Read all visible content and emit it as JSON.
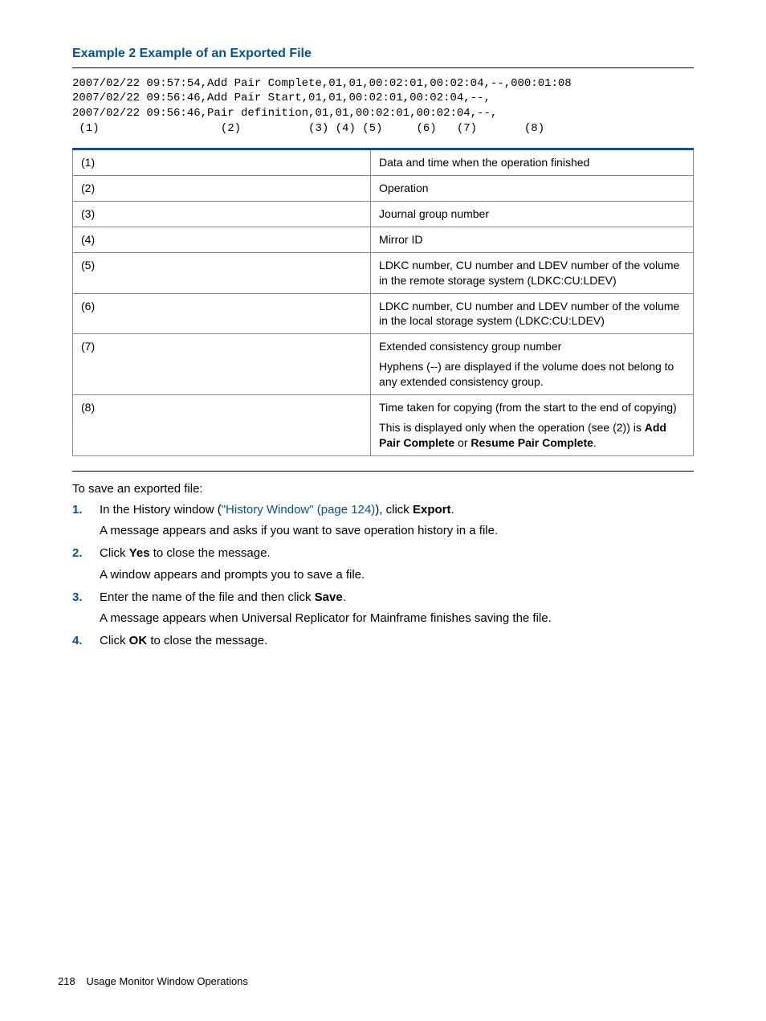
{
  "heading": "Example 2 Example of an Exported File",
  "code_lines": [
    "2007/02/22 09:57:54,Add Pair Complete,01,01,00:02:01,00:02:04,--,000:01:08",
    "2007/02/22 09:56:46,Add Pair Start,01,01,00:02:01,00:02:04,--,",
    "2007/02/22 09:56:46,Pair definition,01,01,00:02:01,00:02:04,--,",
    " (1)                  (2)          (3) (4) (5)     (6)   (7)       (8)"
  ],
  "table": {
    "rows": [
      {
        "key": "(1)",
        "desc": [
          {
            "type": "p",
            "parts": [
              {
                "t": "Data and time when the operation finished"
              }
            ]
          }
        ]
      },
      {
        "key": "(2)",
        "desc": [
          {
            "type": "p",
            "parts": [
              {
                "t": "Operation"
              }
            ]
          }
        ]
      },
      {
        "key": "(3)",
        "desc": [
          {
            "type": "p",
            "parts": [
              {
                "t": "Journal group number"
              }
            ]
          }
        ]
      },
      {
        "key": "(4)",
        "desc": [
          {
            "type": "p",
            "parts": [
              {
                "t": "Mirror ID"
              }
            ]
          }
        ]
      },
      {
        "key": "(5)",
        "desc": [
          {
            "type": "p",
            "parts": [
              {
                "t": "LDKC number, CU number and LDEV number of the volume in the remote storage system (LDKC:CU:LDEV)"
              }
            ]
          }
        ]
      },
      {
        "key": "(6)",
        "desc": [
          {
            "type": "p",
            "parts": [
              {
                "t": "LDKC number, CU number and LDEV number of the volume in the local storage system (LDKC:CU:LDEV)"
              }
            ]
          }
        ]
      },
      {
        "key": "(7)",
        "desc": [
          {
            "type": "p",
            "parts": [
              {
                "t": "Extended consistency group number"
              }
            ]
          },
          {
            "type": "p",
            "parts": [
              {
                "t": "Hyphens (--) are displayed if the volume does not belong to any extended consistency group."
              }
            ]
          }
        ]
      },
      {
        "key": "(8)",
        "desc": [
          {
            "type": "p",
            "parts": [
              {
                "t": "Time taken for copying (from the start to the end of copying)"
              }
            ]
          },
          {
            "type": "p",
            "parts": [
              {
                "t": "This is displayed only when the operation (see (2)) is "
              },
              {
                "t": "Add Pair Complete",
                "bold": true
              },
              {
                "t": " or "
              },
              {
                "t": "Resume Pair Complete",
                "bold": true
              },
              {
                "t": "."
              }
            ]
          }
        ]
      }
    ]
  },
  "intro": "To save an exported file:",
  "steps": [
    {
      "num": "1.",
      "lines": [
        {
          "parts": [
            {
              "t": "In the History window ("
            },
            {
              "t": "\"History Window\" (page 124)",
              "link": true
            },
            {
              "t": "), click "
            },
            {
              "t": "Export",
              "bold": true
            },
            {
              "t": "."
            }
          ]
        },
        {
          "parts": [
            {
              "t": "A message appears and asks if you want to save operation history in a file."
            }
          ]
        }
      ]
    },
    {
      "num": "2.",
      "lines": [
        {
          "parts": [
            {
              "t": "Click "
            },
            {
              "t": "Yes",
              "bold": true
            },
            {
              "t": " to close the message."
            }
          ]
        },
        {
          "parts": [
            {
              "t": "A window appears and prompts you to save a file."
            }
          ]
        }
      ]
    },
    {
      "num": "3.",
      "lines": [
        {
          "parts": [
            {
              "t": "Enter the name of the file and then click "
            },
            {
              "t": "Save",
              "bold": true
            },
            {
              "t": "."
            }
          ]
        },
        {
          "parts": [
            {
              "t": "A message appears when Universal Replicator for Mainframe finishes saving the file."
            }
          ]
        }
      ]
    },
    {
      "num": "4.",
      "lines": [
        {
          "parts": [
            {
              "t": "Click "
            },
            {
              "t": "OK",
              "bold": true
            },
            {
              "t": " to close the message."
            }
          ]
        }
      ]
    }
  ],
  "footer": {
    "page": "218",
    "section": "Usage Monitor Window Operations"
  }
}
